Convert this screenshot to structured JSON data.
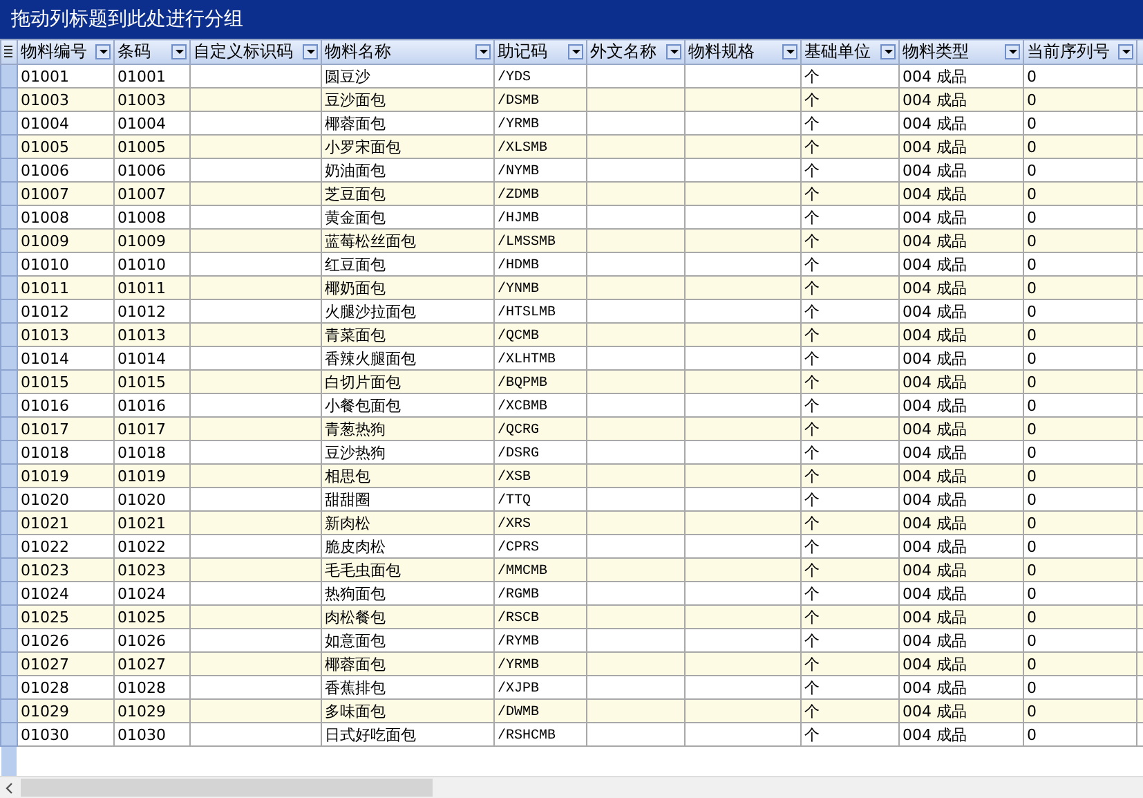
{
  "group_panel": {
    "hint": "拖动列标题到此处进行分组"
  },
  "table": {
    "columns": [
      "物料编号",
      "条码",
      "自定义标识码",
      "物料名称",
      "助记码",
      "外文名称",
      "物料规格",
      "基础单位",
      "物料类型",
      "当前序列号"
    ],
    "rows": [
      {
        "code": "01001",
        "barcode": "01001",
        "name": "圆豆沙",
        "mnemonic": "/YDS",
        "unit": "个",
        "type": "004 成品",
        "serial": "0"
      },
      {
        "code": "01003",
        "barcode": "01003",
        "name": "豆沙面包",
        "mnemonic": "/DSMB",
        "unit": "个",
        "type": "004 成品",
        "serial": "0"
      },
      {
        "code": "01004",
        "barcode": "01004",
        "name": "椰蓉面包",
        "mnemonic": "/YRMB",
        "unit": "个",
        "type": "004 成品",
        "serial": "0"
      },
      {
        "code": "01005",
        "barcode": "01005",
        "name": "小罗宋面包",
        "mnemonic": "/XLSMB",
        "unit": "个",
        "type": "004 成品",
        "serial": "0"
      },
      {
        "code": "01006",
        "barcode": "01006",
        "name": "奶油面包",
        "mnemonic": "/NYMB",
        "unit": "个",
        "type": "004 成品",
        "serial": "0"
      },
      {
        "code": "01007",
        "barcode": "01007",
        "name": "芝豆面包",
        "mnemonic": "/ZDMB",
        "unit": "个",
        "type": "004 成品",
        "serial": "0"
      },
      {
        "code": "01008",
        "barcode": "01008",
        "name": "黄金面包",
        "mnemonic": "/HJMB",
        "unit": "个",
        "type": "004 成品",
        "serial": "0"
      },
      {
        "code": "01009",
        "barcode": "01009",
        "name": "蓝莓松丝面包",
        "mnemonic": "/LMSSMB",
        "unit": "个",
        "type": "004 成品",
        "serial": "0"
      },
      {
        "code": "01010",
        "barcode": "01010",
        "name": "红豆面包",
        "mnemonic": "/HDMB",
        "unit": "个",
        "type": "004 成品",
        "serial": "0"
      },
      {
        "code": "01011",
        "barcode": "01011",
        "name": "椰奶面包",
        "mnemonic": "/YNMB",
        "unit": "个",
        "type": "004 成品",
        "serial": "0"
      },
      {
        "code": "01012",
        "barcode": "01012",
        "name": "火腿沙拉面包",
        "mnemonic": "/HTSLMB",
        "unit": "个",
        "type": "004 成品",
        "serial": "0"
      },
      {
        "code": "01013",
        "barcode": "01013",
        "name": "青菜面包",
        "mnemonic": "/QCMB",
        "unit": "个",
        "type": "004 成品",
        "serial": "0"
      },
      {
        "code": "01014",
        "barcode": "01014",
        "name": "香辣火腿面包",
        "mnemonic": "/XLHTMB",
        "unit": "个",
        "type": "004 成品",
        "serial": "0"
      },
      {
        "code": "01015",
        "barcode": "01015",
        "name": "白切片面包",
        "mnemonic": "/BQPMB",
        "unit": "个",
        "type": "004 成品",
        "serial": "0"
      },
      {
        "code": "01016",
        "barcode": "01016",
        "name": "小餐包面包",
        "mnemonic": "/XCBMB",
        "unit": "个",
        "type": "004 成品",
        "serial": "0"
      },
      {
        "code": "01017",
        "barcode": "01017",
        "name": "青葱热狗",
        "mnemonic": "/QCRG",
        "unit": "个",
        "type": "004 成品",
        "serial": "0"
      },
      {
        "code": "01018",
        "barcode": "01018",
        "name": "豆沙热狗",
        "mnemonic": "/DSRG",
        "unit": "个",
        "type": "004 成品",
        "serial": "0"
      },
      {
        "code": "01019",
        "barcode": "01019",
        "name": "相思包",
        "mnemonic": "/XSB",
        "unit": "个",
        "type": "004 成品",
        "serial": "0"
      },
      {
        "code": "01020",
        "barcode": "01020",
        "name": "甜甜圈",
        "mnemonic": "/TTQ",
        "unit": "个",
        "type": "004 成品",
        "serial": "0"
      },
      {
        "code": "01021",
        "barcode": "01021",
        "name": "新肉松",
        "mnemonic": "/XRS",
        "unit": "个",
        "type": "004 成品",
        "serial": "0"
      },
      {
        "code": "01022",
        "barcode": "01022",
        "name": "脆皮肉松",
        "mnemonic": "/CPRS",
        "unit": "个",
        "type": "004 成品",
        "serial": "0"
      },
      {
        "code": "01023",
        "barcode": "01023",
        "name": "毛毛虫面包",
        "mnemonic": "/MMCMB",
        "unit": "个",
        "type": "004 成品",
        "serial": "0"
      },
      {
        "code": "01024",
        "barcode": "01024",
        "name": "热狗面包",
        "mnemonic": "/RGMB",
        "unit": "个",
        "type": "004 成品",
        "serial": "0"
      },
      {
        "code": "01025",
        "barcode": "01025",
        "name": "肉松餐包",
        "mnemonic": "/RSCB",
        "unit": "个",
        "type": "004 成品",
        "serial": "0"
      },
      {
        "code": "01026",
        "barcode": "01026",
        "name": "如意面包",
        "mnemonic": "/RYMB",
        "unit": "个",
        "type": "004 成品",
        "serial": "0"
      },
      {
        "code": "01027",
        "barcode": "01027",
        "name": "椰蓉面包",
        "mnemonic": "/YRMB",
        "unit": "个",
        "type": "004 成品",
        "serial": "0"
      },
      {
        "code": "01028",
        "barcode": "01028",
        "name": "香蕉排包",
        "mnemonic": "/XJPB",
        "unit": "个",
        "type": "004 成品",
        "serial": "0"
      },
      {
        "code": "01029",
        "barcode": "01029",
        "name": "多味面包",
        "mnemonic": "/DWMB",
        "unit": "个",
        "type": "004 成品",
        "serial": "0"
      },
      {
        "code": "01030",
        "barcode": "01030",
        "name": "日式好吃面包",
        "mnemonic": "/RSHCMB",
        "unit": "个",
        "type": "004 成品",
        "serial": "0"
      }
    ]
  }
}
